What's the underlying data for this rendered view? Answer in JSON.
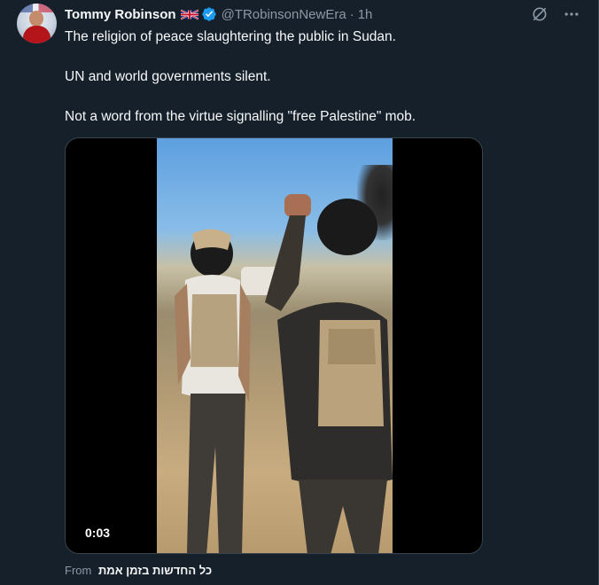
{
  "tweet": {
    "author_name": "Tommy Robinson",
    "author_flag_emoji": "🇬🇧",
    "verified": true,
    "handle": "@TRobinsonNewEra",
    "separator": "·",
    "time": "1h",
    "paragraphs": [
      "The religion of peace slaughtering the public in Sudan.",
      "UN and world governments silent.",
      "Not a word from the virtue signalling \"free Palestine\" mob."
    ],
    "video": {
      "duration": "0:03"
    },
    "source_prefix": "From",
    "source_name": "כל החדשות בזמן אמת"
  },
  "icons": {
    "grok": "grok-icon",
    "more": "more-icon",
    "verified": "verified-badge-icon",
    "flag": "uk-flag-icon"
  },
  "colors": {
    "background": "#15202b",
    "text": "#f7f9f9",
    "secondary_text": "#8b98a5",
    "verified_blue": "#1d9bf0",
    "border": "#38444d"
  }
}
